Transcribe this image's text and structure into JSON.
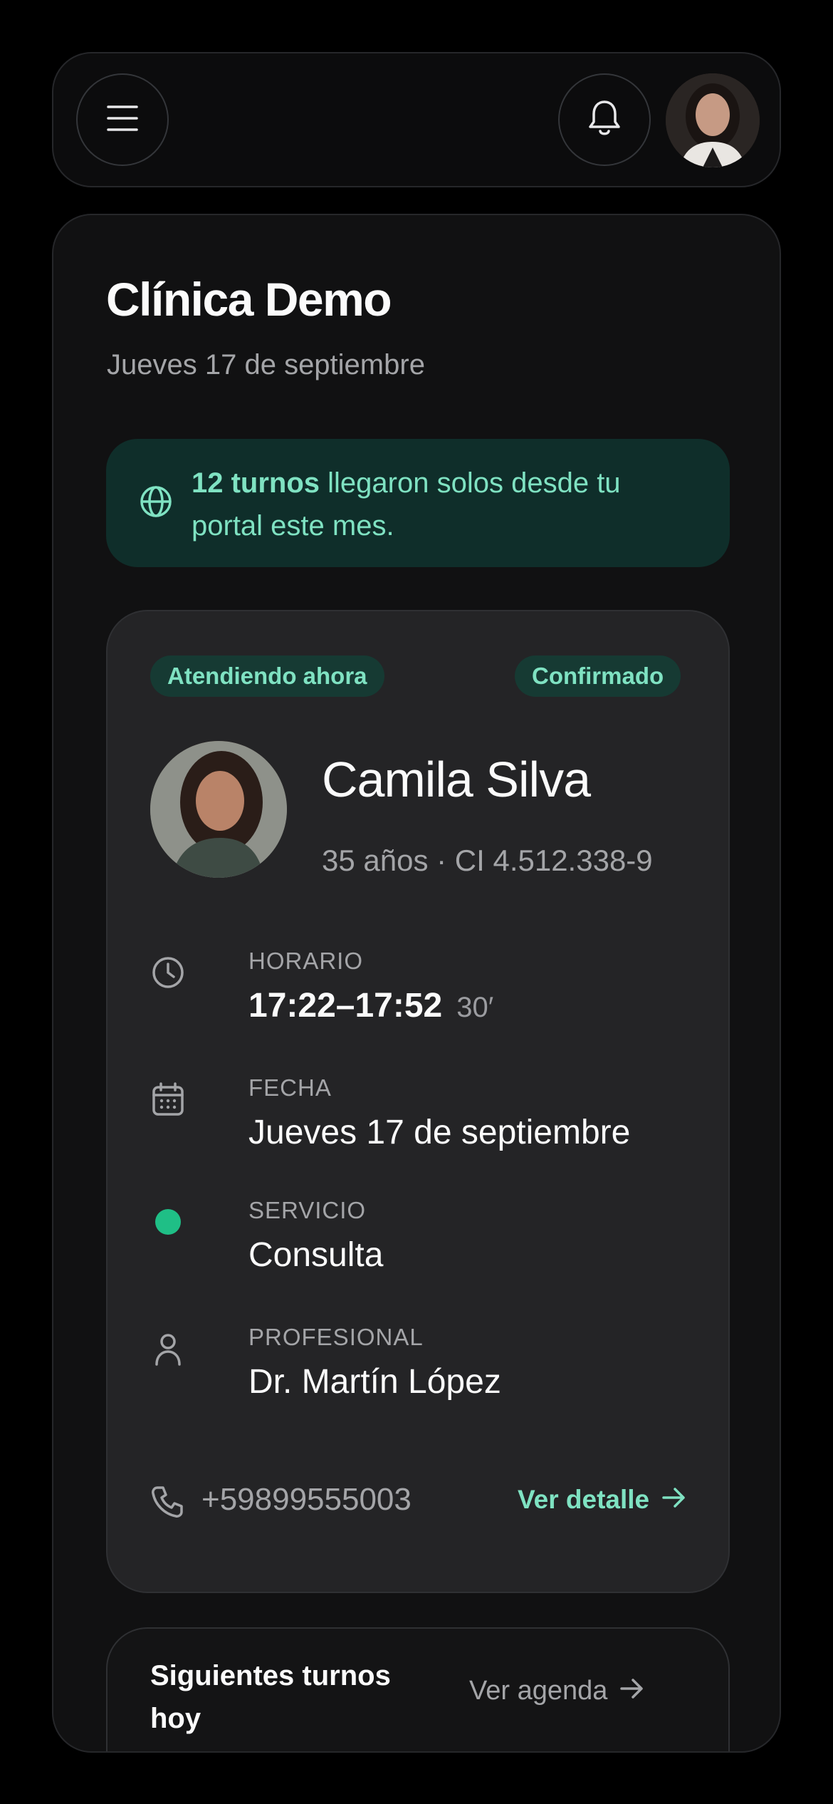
{
  "topbar": {
    "menu_icon": "menu-icon",
    "bell_icon": "bell-icon",
    "user_avatar": "avatar"
  },
  "header": {
    "title": "Clínica Demo",
    "date": "Jueves 17 de septiembre"
  },
  "banner": {
    "icon": "globe-icon",
    "highlight": "12 turnos",
    "text": " llegaron solos desde tu portal este mes."
  },
  "appointment": {
    "status_now": "Atendiendo ahora",
    "status_confirm": "Confirmado",
    "patient": {
      "name": "Camila Silva",
      "meta": "35 años · CI 4.512.338-9"
    },
    "rows": [
      {
        "label": "HORARIO",
        "value": "17:22–17:52",
        "extra": "30′",
        "icon": "clock-icon"
      },
      {
        "label": "FECHA",
        "value": "Jueves 17 de septiembre",
        "icon": "calendar-icon"
      },
      {
        "label": "SERVICIO",
        "value": "Consulta",
        "icon": "dot-icon",
        "color": "#1fbf86"
      },
      {
        "label": "PROFESIONAL",
        "value": "Dr. Martín López",
        "icon": "user-icon"
      }
    ],
    "phone": "+59899555003",
    "detail_link": "Ver detalle"
  },
  "next_section": {
    "title": "Siguientes turnos hoy",
    "link": "Ver agenda"
  },
  "colors": {
    "accent": "#7fe2c2",
    "banner_bg": "#0f2e2a",
    "card_bg": "#242426",
    "service_dot": "#1fbf86"
  }
}
